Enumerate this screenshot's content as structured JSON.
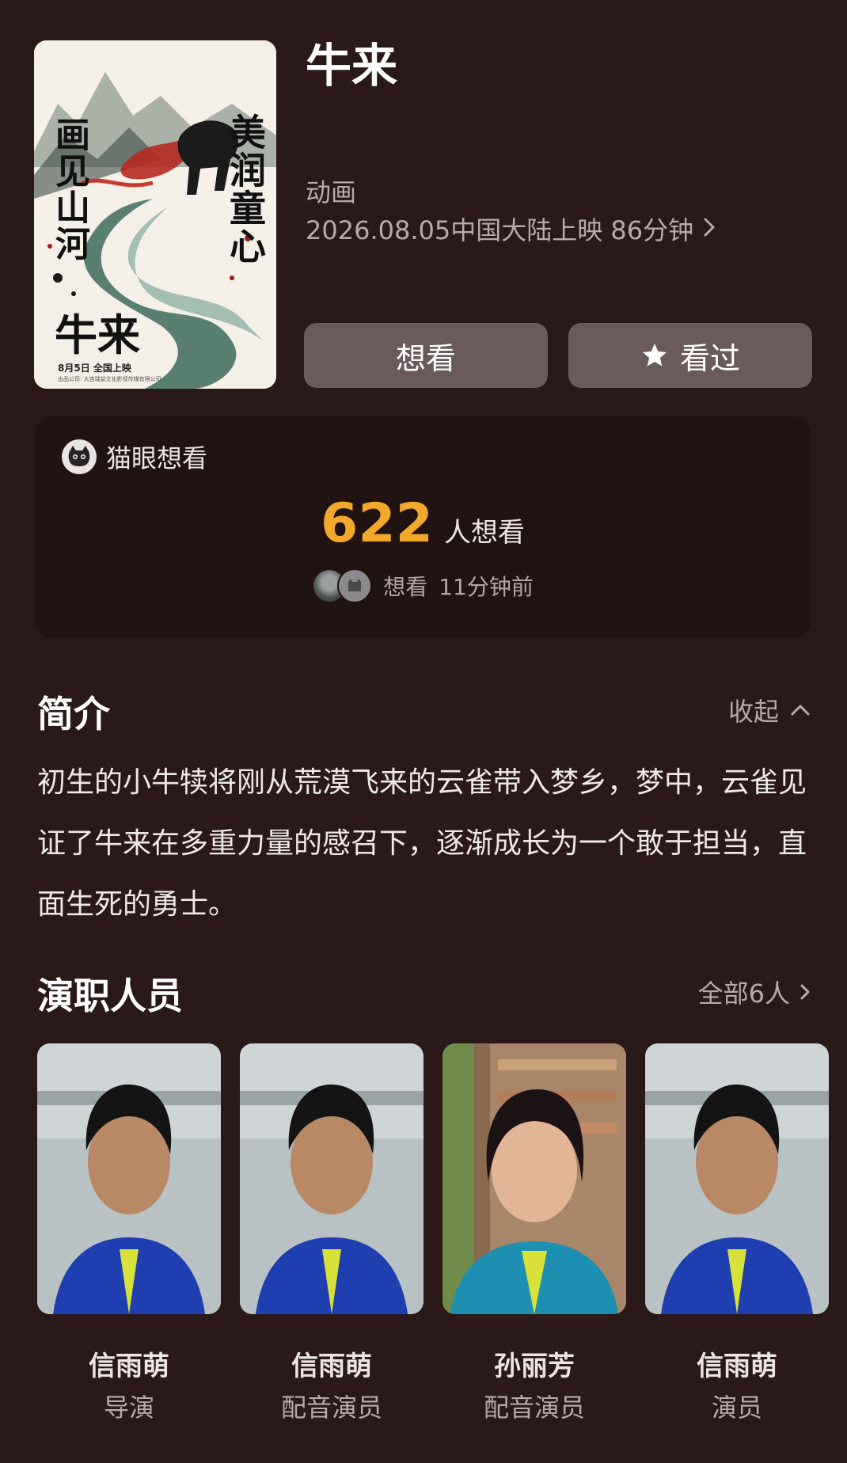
{
  "movie": {
    "title": "牛来",
    "genre": "动画",
    "release_info": "2026.08.05中国大陆上映 86分钟"
  },
  "poster": {
    "left_text": "画见山河",
    "right_text": "美润童心",
    "title_text": "牛来",
    "date_text": "8月5日  全国上映",
    "credit_text": "出品公司: 大连瑞益文化影视传媒有限公司"
  },
  "actions": {
    "want_label": "想看",
    "watched_label": "看过"
  },
  "maoyan": {
    "label": "猫眼想看",
    "count": "622",
    "count_suffix": "人想看",
    "recent_action": "想看",
    "recent_time": "11分钟前"
  },
  "synopsis": {
    "title": "简介",
    "toggle_label": "收起",
    "text": "初生的小牛犊将刚从荒漠飞来的云雀带入梦乡，梦中，云雀见证了牛来在多重力量的感召下，逐渐成长为一个敢于担当，直面生死的勇士。"
  },
  "cast": {
    "title": "演职人员",
    "all_label": "全部6人",
    "members": [
      {
        "name": "信雨萌",
        "role": "导演"
      },
      {
        "name": "信雨萌",
        "role": "配音演员"
      },
      {
        "name": "孙丽芳",
        "role": "配音演员"
      },
      {
        "name": "信雨萌",
        "role": "演员"
      }
    ]
  },
  "colors": {
    "background": "#2b1818",
    "card": "#221313",
    "button": "#6b5a5a",
    "accent_count": "#f2a92b"
  }
}
